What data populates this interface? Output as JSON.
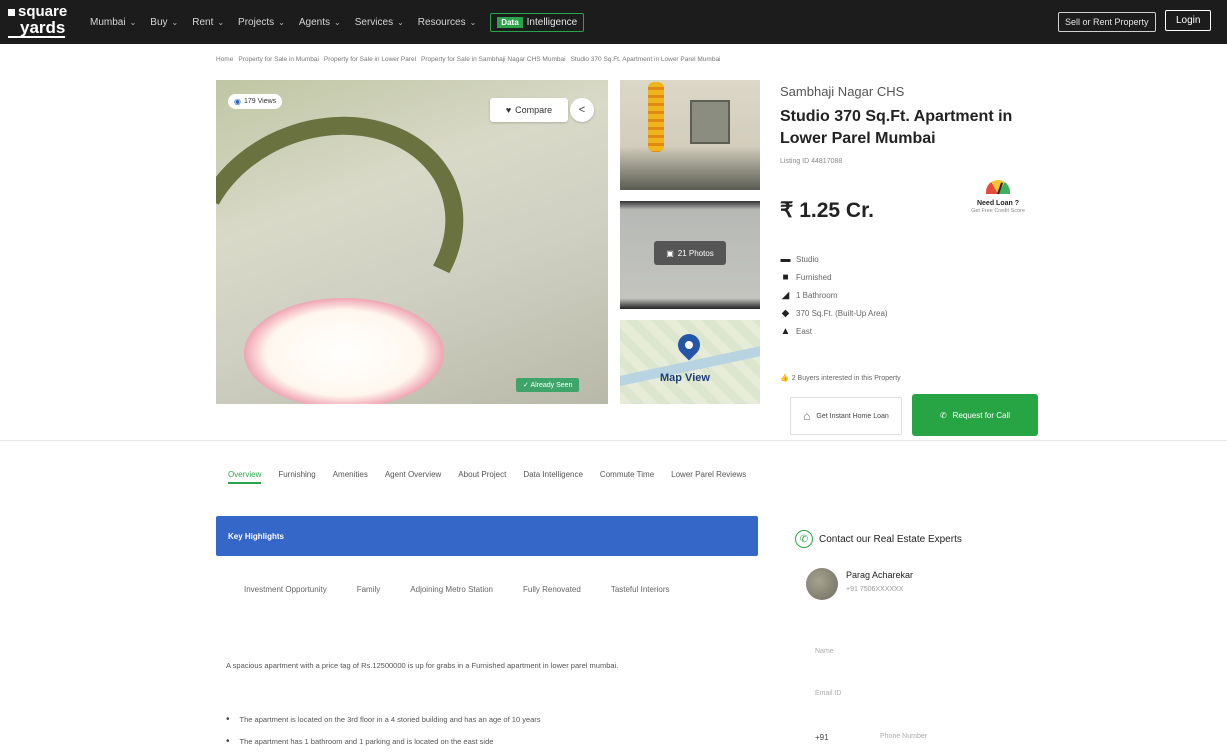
{
  "header": {
    "logo_top": "square",
    "logo_bottom": "yards",
    "nav": [
      "Mumbai",
      "Buy",
      "Rent",
      "Projects",
      "Agents",
      "Services",
      "Resources"
    ],
    "intel_badge": "Data",
    "intel_label": "Intelligence",
    "sell_label": "Sell or Rent Property",
    "login_label": "Login"
  },
  "breadcrumb": [
    "Home",
    "Property for Sale in Mumbai",
    "Property for Sale in Lower Parel",
    "Property for Sale in Sambhaji Nagar CHS Mumbai",
    "Studio 370 Sq.Ft. Apartment in Lower Parel Mumbai"
  ],
  "gallery": {
    "views": "179 Views",
    "compare": "Compare",
    "seen": "Already Seen",
    "photos": "21 Photos",
    "map": "Map View"
  },
  "property": {
    "project": "Sambhaji Nagar CHS",
    "title": "Studio 370 Sq.Ft. Apartment in Lower Parel Mumbai",
    "listing_id": "Listing ID 44817088",
    "price": "₹ 1.25 Cr.",
    "loan_title": "Need Loan ?",
    "loan_sub": "Get Free Credit Score",
    "features": [
      {
        "icon": "bed-icon",
        "label": "Studio"
      },
      {
        "icon": "sofa-icon",
        "label": "Furnished"
      },
      {
        "icon": "bath-icon",
        "label": "1 Bathroom"
      },
      {
        "icon": "area-icon",
        "label": "370 Sq.Ft. (Built-Up Area)"
      },
      {
        "icon": "compass-icon",
        "label": "East"
      }
    ],
    "interested": "2 Buyers interested in this Property",
    "instant_loan": "Get Instant Home Loan",
    "call": "Request for Call"
  },
  "tabs": [
    "Overview",
    "Furnishing",
    "Amenities",
    "Agent Overview",
    "About Project",
    "Data Intelligence",
    "Commute Time",
    "Lower Parel Reviews"
  ],
  "highlights": {
    "title": "Key Highlights",
    "chips": [
      "Investment Opportunity",
      "Family",
      "Adjoining Metro Station",
      "Fully Renovated",
      "Tasteful Interiors"
    ],
    "description": "A spacious apartment with a price tag of Rs.12500000 is up for grabs in a Furnished apartment in lower parel mumbai.",
    "bullets": [
      "The apartment is located on the 3rd floor in a 4 storied building and has an age of 10 years",
      "The apartment has 1 bathroom and 1 parking and is located on the east side"
    ]
  },
  "contact": {
    "title": "Contact our Real Estate Experts",
    "agent_name": "Parag Acharekar",
    "agent_phone": "+91 7506XXXXXX",
    "name_placeholder": "Name",
    "email_placeholder": "Email ID",
    "phone_code": "+91",
    "phone_placeholder": "Phone Number"
  }
}
